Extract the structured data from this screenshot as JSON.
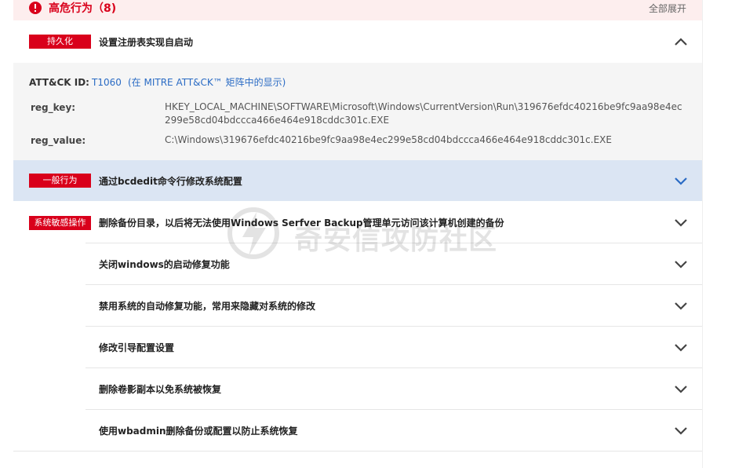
{
  "header": {
    "title": "高危行为（8)",
    "expand_all": "全部展开"
  },
  "persist": {
    "tag": "持久化",
    "title": "设置注册表实现自启动",
    "expanded": true,
    "detail": {
      "attck_label": "ATT&CK ID:",
      "attck_id": "T1060",
      "attck_link": "(在 MITRE ATT&CK™ 矩阵中的显示)",
      "reg_key_label": "reg_key:",
      "reg_key_value": "HKEY_LOCAL_MACHINE\\SOFTWARE\\Microsoft\\Windows\\CurrentVersion\\Run\\319676efdc40216be9fc9aa98e4ec299e58cd04bdccca466e464e918cddc301c.EXE",
      "reg_value_label": "reg_value:",
      "reg_value_value": "C:\\Windows\\319676efdc40216be9fc9aa98e4ec299e58cd04bdccca466e464e918cddc301c.EXE"
    }
  },
  "general": {
    "tag": "一般行为",
    "title": "通过bcdedit命令行修改系统配置"
  },
  "sensitive": {
    "tag": "系统敏感操作",
    "items": [
      "删除备份目录，以后将无法使用Windows Serfver Backup管理单元访问该计算机创建的备份",
      "关闭windows的启动修复功能",
      "禁用系统的自动修复功能，常用来隐藏对系统的修改",
      "修改引导配置设置",
      "删除卷影副本以免系统被恢复",
      "使用wbadmin删除备份或配置以防止系统恢复"
    ]
  },
  "watermark": {
    "text": "奇安信攻防社区"
  },
  "colors": {
    "danger": "#d9001b",
    "link": "#2a6bc4",
    "selected_row": "#dbe5f3",
    "header_bg": "#fdeeee"
  }
}
